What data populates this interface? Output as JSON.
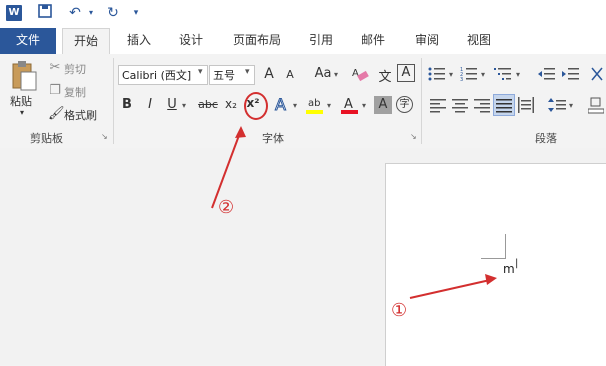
{
  "qat": {
    "logo": "W"
  },
  "tabs": [
    "文件",
    "开始",
    "插入",
    "设计",
    "页面布局",
    "引用",
    "邮件",
    "审阅",
    "视图"
  ],
  "clipboard": {
    "paste": "粘贴",
    "cut": "剪切",
    "copy": "复制",
    "format_painter": "格式刷",
    "group": "剪贴板"
  },
  "font": {
    "name": "Calibri (西文]",
    "size": "五号",
    "group": "字体",
    "bold": "B",
    "italic": "I",
    "underline": "U",
    "strike": "abc",
    "subscript": "x₂",
    "superscript": "x²",
    "grow": "A",
    "shrink": "A",
    "case": "Aa",
    "clear_icon": "eraser-icon",
    "wen": "文",
    "A_box": "A",
    "zi": "字"
  },
  "paragraph": {
    "group": "段落"
  },
  "colors": {
    "accent": "#2b579a",
    "highlight": "#ffff00",
    "font_color": "#e81123",
    "annotation": "#d32f2f"
  },
  "document": {
    "text": "m",
    "superscript_cursor": "|"
  },
  "annotations": {
    "step1": "①",
    "step2": "②"
  }
}
